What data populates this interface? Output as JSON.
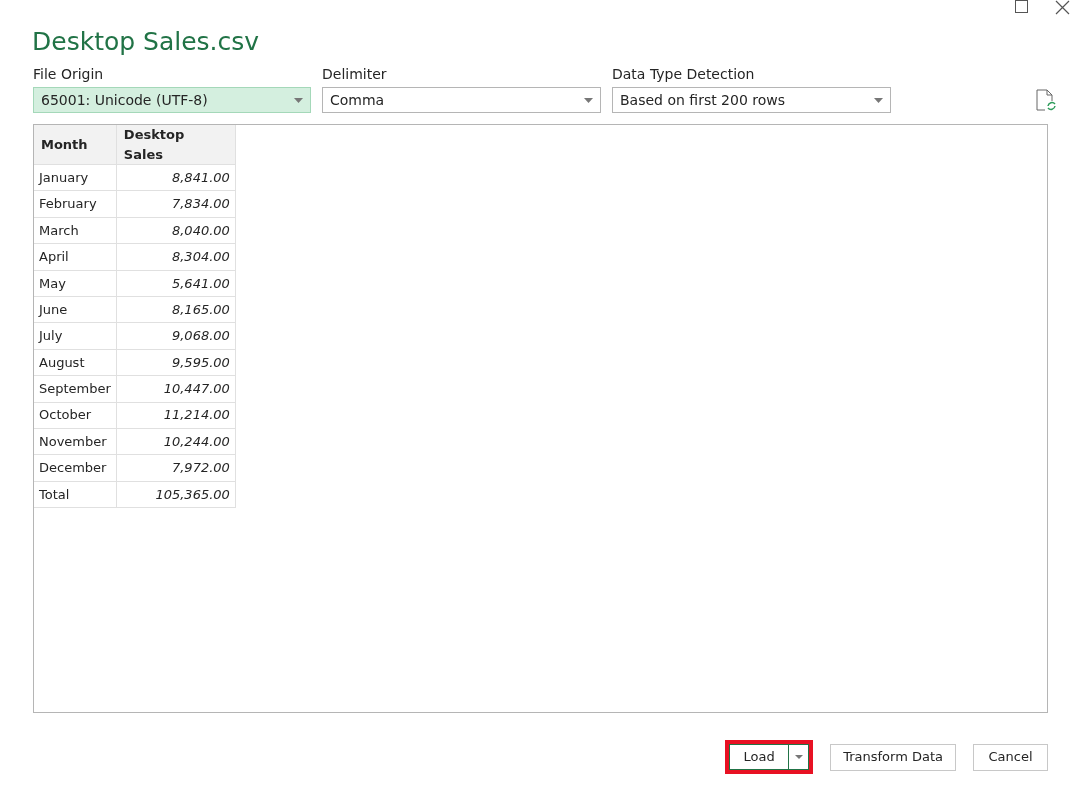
{
  "window": {
    "title": "Desktop Sales.csv"
  },
  "options": [
    {
      "label": "File Origin",
      "value": "65001: Unicode (UTF-8)",
      "focused": true
    },
    {
      "label": "Delimiter",
      "value": "Comma",
      "focused": false
    },
    {
      "label": "Data Type Detection",
      "value": "Based on first 200 rows",
      "focused": false
    }
  ],
  "table": {
    "columns": [
      "Month",
      "Desktop Sales"
    ],
    "rows": [
      [
        "January",
        "8,841.00"
      ],
      [
        "February",
        "7,834.00"
      ],
      [
        "March",
        "8,040.00"
      ],
      [
        "April",
        "8,304.00"
      ],
      [
        "May",
        "5,641.00"
      ],
      [
        "June",
        "8,165.00"
      ],
      [
        "July",
        "9,068.00"
      ],
      [
        "August",
        "9,595.00"
      ],
      [
        "September",
        "10,447.00"
      ],
      [
        "October",
        "11,214.00"
      ],
      [
        "November",
        "10,244.00"
      ],
      [
        "December",
        "7,972.00"
      ],
      [
        "Total",
        "105,365.00"
      ]
    ]
  },
  "buttons": [
    {
      "label": "Load",
      "kind": "split",
      "highlighted": true
    },
    {
      "label": "Transform Data",
      "kind": "plain",
      "highlighted": false
    },
    {
      "label": "Cancel",
      "kind": "plain",
      "highlighted": false
    }
  ]
}
